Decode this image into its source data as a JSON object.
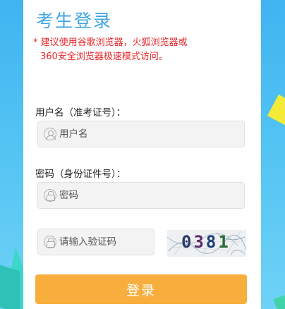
{
  "page": {
    "title": "考生登录",
    "notice_line1": "* 建议使用谷歌浏览器，火狐浏览器或",
    "notice_line2": "360安全浏览器极速模式访问。"
  },
  "form": {
    "username_label": "用户名（准考证号）：",
    "username_placeholder": "用户名",
    "username_value": "",
    "password_label": "密码（身份证件号）：",
    "password_placeholder": "密码",
    "password_value": "",
    "captcha_placeholder": "请输入验证码",
    "captcha_value": "",
    "captcha_image_text": [
      "0",
      "3",
      "8",
      "1"
    ],
    "submit_label": "登录"
  },
  "colors": {
    "title": "#3ea6e6",
    "notice": "#e8272b",
    "button": "#f8ae3d",
    "background": "#4cbdf2"
  },
  "icons": {
    "username": "user-icon",
    "password": "lock-icon",
    "captcha": "lock-icon"
  }
}
